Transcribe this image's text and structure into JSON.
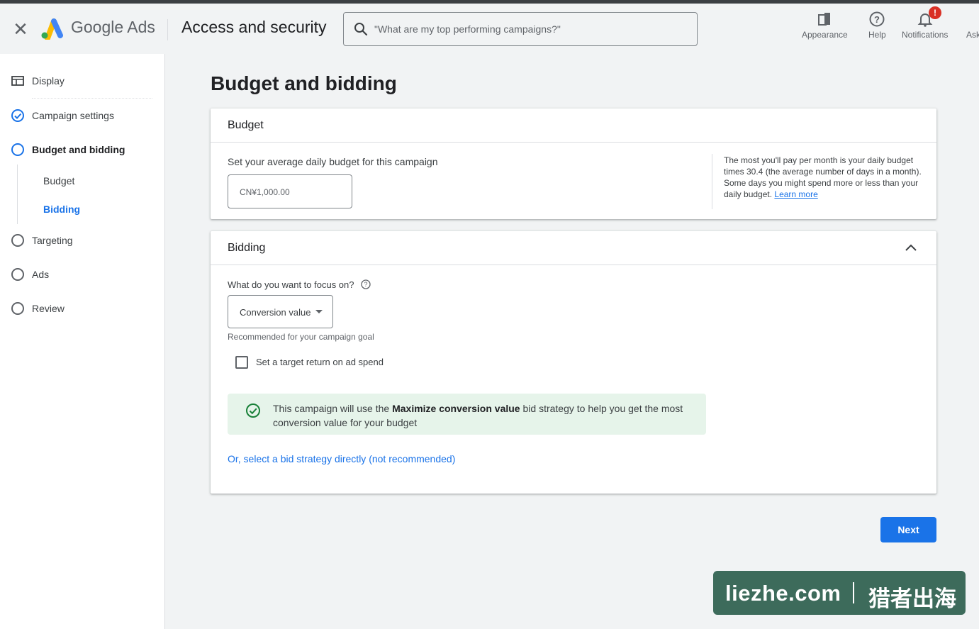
{
  "header": {
    "app_name": "Google Ads",
    "section_title": "Access and security",
    "search_placeholder": "\"What are my top performing campaigns?\"",
    "tools": [
      {
        "label": "Appearance",
        "icon": "appearance-icon"
      },
      {
        "label": "Help",
        "icon": "help-icon"
      },
      {
        "label": "Notifications",
        "icon": "bell-icon",
        "badge": "!"
      },
      {
        "label": "Ask",
        "icon": "ask-icon"
      }
    ]
  },
  "sidebar": {
    "items": [
      {
        "label": "Display",
        "icon": "display-icon",
        "state": "complete"
      },
      {
        "label": "Campaign settings",
        "icon": "check-circle-icon",
        "state": "complete"
      },
      {
        "label": "Budget and bidding",
        "icon": "circle-icon",
        "state": "active"
      },
      {
        "label": "Targeting",
        "icon": "circle-icon",
        "state": "pending"
      },
      {
        "label": "Ads",
        "icon": "circle-icon",
        "state": "pending"
      },
      {
        "label": "Review",
        "icon": "circle-icon",
        "state": "pending"
      }
    ],
    "subitems": [
      {
        "label": "Budget",
        "active": false
      },
      {
        "label": "Bidding",
        "active": true
      }
    ]
  },
  "main": {
    "title": "Budget and bidding",
    "budget": {
      "heading": "Budget",
      "label": "Set your average daily budget for this campaign",
      "value": "CN¥1,000.00",
      "aside_text": "The most you'll pay per month is your daily budget times 30.4 (the average number of days in a month). Some days you might spend more or less than your daily budget.",
      "aside_link": "Learn more"
    },
    "bidding": {
      "heading": "Bidding",
      "question": "What do you want to focus on?",
      "focus_value": "Conversion value",
      "recommended": "Recommended for your campaign goal",
      "checkbox_label": "Set a target return on ad spend",
      "checkbox_checked": false,
      "info_prefix": "This campaign will use the ",
      "info_strategy": "Maximize conversion value",
      "info_suffix": " bid strategy to help you get the most conversion value for your budget",
      "strategy_link": "Or, select a bid strategy directly (not recommended)"
    },
    "next_label": "Next"
  },
  "watermark": {
    "site": "liezhe.com",
    "cn": "猎者出海"
  },
  "colors": {
    "accent": "#1a73e8",
    "success_bg": "#e6f4ea",
    "success": "#188038",
    "badge": "#d93025",
    "watermark_bg": "#3d6b5b"
  }
}
